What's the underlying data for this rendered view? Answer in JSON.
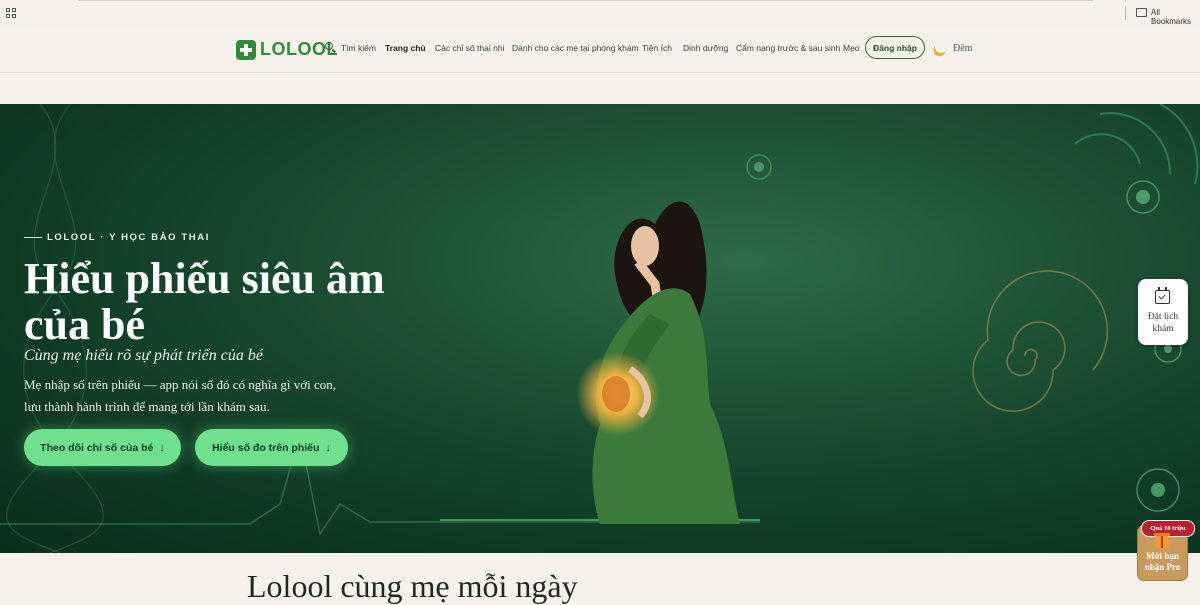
{
  "bookmarks_bar": {
    "all_bookmarks": "All Bookmarks",
    "apps_icon": "grid-icon",
    "folder_icon": "folder-icon"
  },
  "nav": {
    "brand": "LOLOOL",
    "items": [
      {
        "label": "Tìm kiếm"
      },
      {
        "label": "Trang chủ",
        "active": true
      },
      {
        "label": "Các chỉ số thai nhi"
      },
      {
        "label": "Dành cho các mẹ tại phòng khám"
      },
      {
        "label": "Tiện ích"
      },
      {
        "label": "Dinh dưỡng"
      },
      {
        "label": "Cẩm nang trước & sau sinh"
      },
      {
        "label": "Mẹo"
      }
    ],
    "login": "Đăng nhập",
    "night": "Đêm"
  },
  "hero": {
    "eyebrow": "LOLOOL · Y HỌC BÀO THAI",
    "title": "Hiểu phiếu siêu âm của bé",
    "subtitle": "Cùng mẹ hiểu rõ sự phát triển của bé",
    "description": "Mẹ nhập số trên phiếu — app nói số đó có nghĩa gì với con, lưu thành hành trình để mang tới lần khám sau.",
    "primary_button": "Theo dõi chỉ số của bé",
    "secondary_button": "Hiểu số đo trên phiếu",
    "accent_color": "#6fe08c",
    "background_color": "#1c5033"
  },
  "floating": {
    "booking": "Đặt lịch khám",
    "gift_badge": "Quà 10 triệu",
    "gift_label": "Mời bạn nhận Pro"
  },
  "section": {
    "title": "Lolool cùng mẹ mỗi ngày"
  }
}
